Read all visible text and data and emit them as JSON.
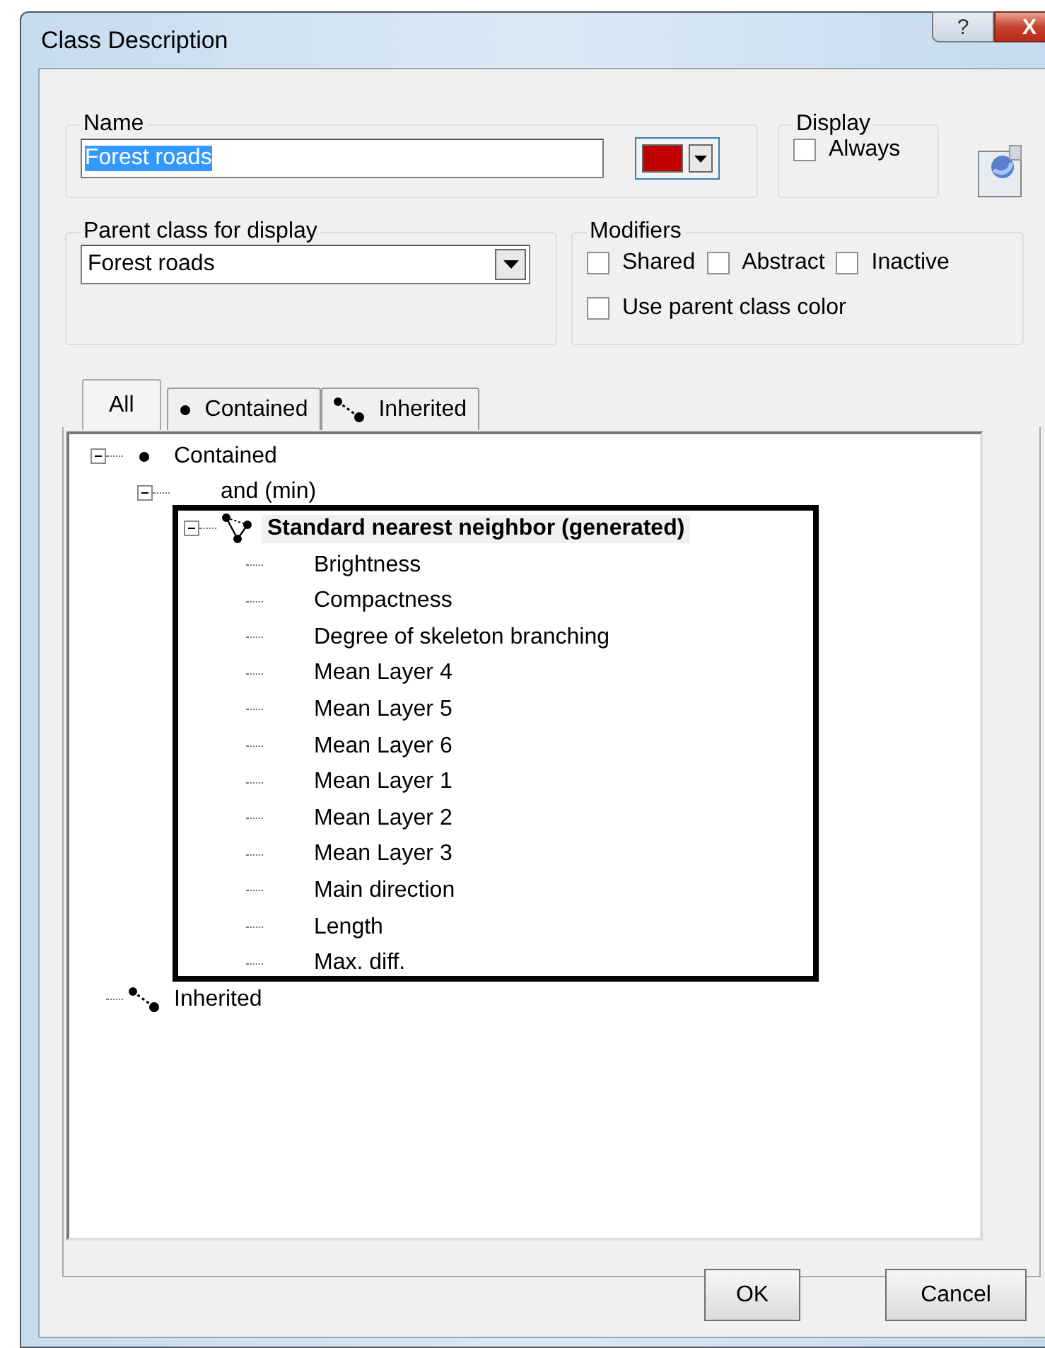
{
  "window": {
    "title": "Class Description",
    "help_button": "?",
    "close_button": "X"
  },
  "name_group": {
    "label": "Name",
    "value": "Forest roads",
    "swatch": {
      "color": "#c00000"
    }
  },
  "display_group": {
    "label": "Display",
    "checkboxes": [
      {
        "label": "Always",
        "checked": false
      }
    ]
  },
  "parent_group": {
    "label": "Parent class for display",
    "value": "Forest roads"
  },
  "modifiers_group": {
    "label": "Modifiers",
    "checkboxes": [
      {
        "label": "Shared",
        "checked": false
      },
      {
        "label": "Abstract",
        "checked": false
      },
      {
        "label": "Inactive",
        "checked": false
      },
      {
        "label": "Use parent class color",
        "checked": false
      }
    ]
  },
  "tabs": [
    {
      "label": "All",
      "kind": "plain",
      "selected": true
    },
    {
      "label": "Contained",
      "kind": "contained",
      "selected": false
    },
    {
      "label": "Inherited",
      "kind": "inherited",
      "selected": false
    }
  ],
  "tree": [
    {
      "label": "Contained",
      "kind": "contained",
      "expanded": true,
      "selected": false,
      "children": [
        {
          "label": "and (min)",
          "expanded": true,
          "selected": false,
          "children": [
            {
              "label": "Standard nearest neighbor (generated)",
              "kind": "neighbor",
              "expanded": true,
              "selected": true,
              "children": [
                {
                  "label": "Brightness",
                  "selected": false
                },
                {
                  "label": "Compactness",
                  "selected": false
                },
                {
                  "label": "Degree of skeleton branching",
                  "selected": false
                },
                {
                  "label": "Mean Layer 4",
                  "selected": false
                },
                {
                  "label": "Mean Layer 5",
                  "selected": false
                },
                {
                  "label": "Mean Layer 6",
                  "selected": false
                },
                {
                  "label": "Mean Layer 1",
                  "selected": false
                },
                {
                  "label": "Mean Layer 2",
                  "selected": false
                },
                {
                  "label": "Mean Layer 3",
                  "selected": false
                },
                {
                  "label": "Main direction",
                  "selected": false
                },
                {
                  "label": "Length",
                  "selected": false
                },
                {
                  "label": "Max. diff.",
                  "selected": false
                }
              ]
            }
          ]
        }
      ]
    },
    {
      "label": "Inherited",
      "kind": "inherited",
      "selected": false
    }
  ],
  "buttons": [
    {
      "label": "OK"
    },
    {
      "label": "Cancel"
    }
  ]
}
